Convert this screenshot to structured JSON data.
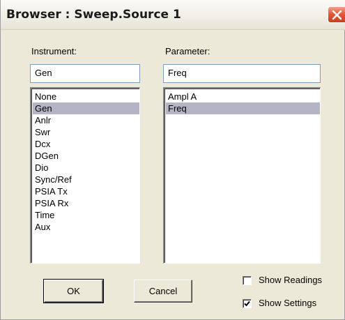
{
  "window": {
    "title": "Browser : Sweep.Source 1",
    "close_icon": "close-icon"
  },
  "instrument": {
    "label": "Instrument:",
    "value": "Gen",
    "items": [
      "None",
      "Gen",
      "Anlr",
      "Swr",
      "Dcx",
      "DGen",
      "Dio",
      "Sync/Ref",
      "PSIA Tx",
      "PSIA Rx",
      "Time",
      "Aux"
    ],
    "selected": "Gen"
  },
  "parameter": {
    "label": "Parameter:",
    "value": "Freq",
    "items": [
      "Ampl A",
      "Freq"
    ],
    "selected": "Freq"
  },
  "buttons": {
    "ok": "OK",
    "cancel": "Cancel"
  },
  "options": {
    "show_readings": {
      "label": "Show Readings",
      "checked": false
    },
    "show_settings": {
      "label": "Show Settings",
      "checked": true
    }
  },
  "colors": {
    "selection": "#b4b4c4",
    "close_button": "#e0593a"
  }
}
